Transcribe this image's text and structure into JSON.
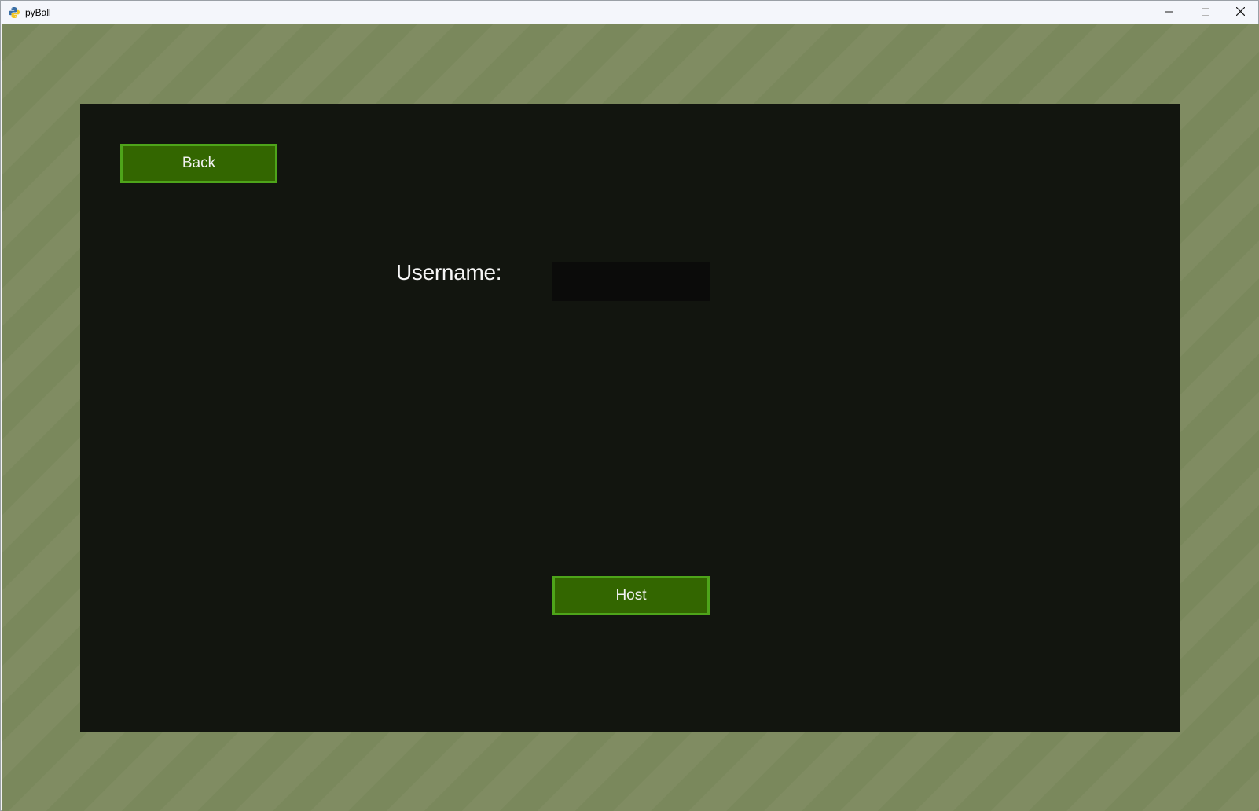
{
  "window": {
    "title": "pyBall",
    "icon": "python-icon",
    "controls": {
      "minimize_icon": "minimize-icon",
      "maximize_icon": "maximize-icon",
      "close_icon": "close-icon"
    }
  },
  "screen": {
    "back_label": "Back",
    "username_label": "Username:",
    "username_value": "",
    "host_label": "Host"
  },
  "colors": {
    "background_stripe_a": "#7a885c",
    "background_stripe_b": "#808c62",
    "panel": "#12150f",
    "button_fill": "#336600",
    "button_border": "#4ea41a",
    "input_fill": "#0b0b0a",
    "text": "#f5f5f5"
  }
}
